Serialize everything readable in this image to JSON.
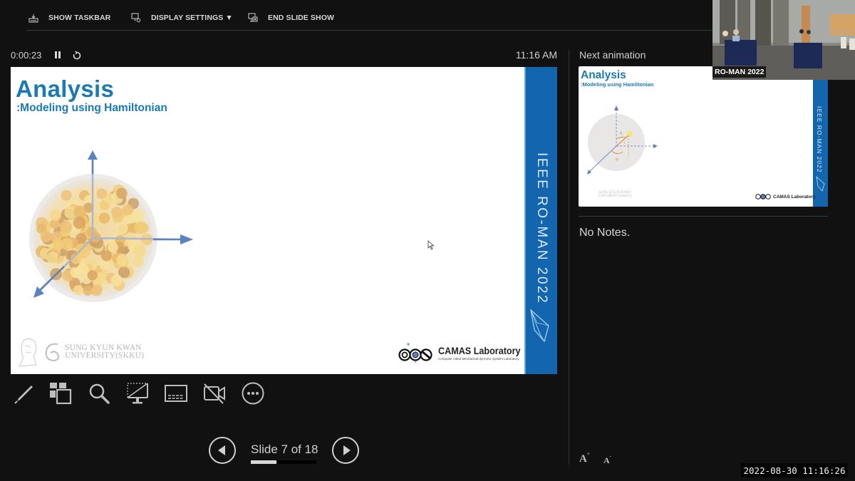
{
  "toolbar": {
    "show_taskbar": "SHOW TASKBAR",
    "display_settings": "DISPLAY SETTINGS ▼",
    "end_slide_show": "END SLIDE SHOW"
  },
  "presenter": {
    "elapsed_time": "0:00:23",
    "clock": "11:16 AM"
  },
  "current_slide": {
    "title": "Analysis",
    "subtitle": ":Modeling using Hamiltonian",
    "band_text": "IEEE RO-MAN 2022",
    "university_line1": "SUNG KYUN KWAN",
    "university_line2": "UNIVERSITY(SKKU)",
    "lab_name": "CAMAS Laboratory",
    "lab_subtitle": "Computer Aided Mechanical dynAmic System Laboratory"
  },
  "tools": [
    {
      "name": "pen-tool",
      "label": "Pen and laser pointer tools"
    },
    {
      "name": "see-all-slides",
      "label": "See all slides"
    },
    {
      "name": "zoom-into-slide",
      "label": "Zoom into the slide"
    },
    {
      "name": "black-or-unblack",
      "label": "Black or unblack slide show"
    },
    {
      "name": "toggle-subtitles",
      "label": "Toggle subtitles"
    },
    {
      "name": "toggle-camera",
      "label": "Toggle camera"
    },
    {
      "name": "more-options",
      "label": "More slide show options"
    }
  ],
  "navigation": {
    "slide_counter": "Slide 7 of 18",
    "current": 7,
    "total": 18,
    "progress_fraction": 0.389
  },
  "next_panel": {
    "label": "Next animation",
    "thumb_title": "Analysis",
    "thumb_subtitle": ":Modeling using Hamiltonian",
    "thumb_band_text": "IEEE RO-MAN 2022",
    "thumb_lab": "CAMAS Laboratory",
    "thumb_skku_1": "SUNG KYUN KWAN",
    "thumb_skku_2": "UNIVERSITY(SKKU)",
    "symbols": {
      "theta": "θ",
      "phi": "φ",
      "r": "r"
    }
  },
  "notes": {
    "text": "No Notes.",
    "font_up": "A",
    "font_down": "A"
  },
  "webcam": {
    "label": "RO-MAN 2022"
  },
  "recording_timestamp": "2022-08-30  11:16:26",
  "colors": {
    "accent_blue": "#1b79b4",
    "band_blue": "#1366ad",
    "background": "#111111"
  }
}
